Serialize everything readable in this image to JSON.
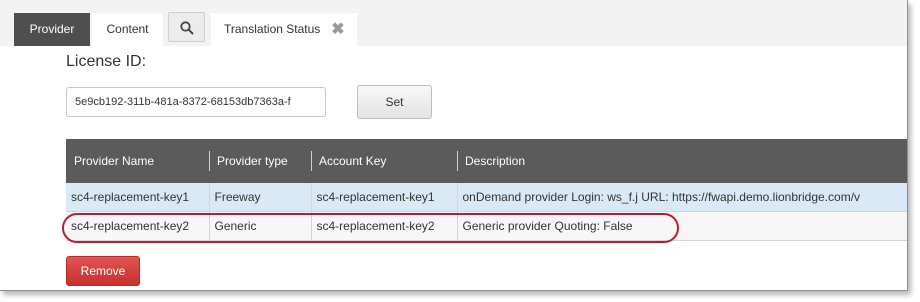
{
  "tabs": {
    "provider": "Provider",
    "content": "Content",
    "search_icon": "search-icon",
    "translation_status": "Translation Status",
    "close_icon": "close-icon",
    "close_glyph": "✖"
  },
  "license": {
    "label": "License ID:",
    "value": "5e9cb192-311b-481a-8372-68153db7363a-f",
    "set_label": "Set"
  },
  "table": {
    "headers": [
      "Provider Name",
      "Provider type",
      "Account Key",
      "Description"
    ],
    "rows": [
      [
        "sc4-replacement-key1",
        "Freeway",
        "sc4-replacement-key1",
        "onDemand provider Login: ws_f.j URL: https://fwapi.demo.lionbridge.com/v"
      ],
      [
        "sc4-replacement-key2",
        "Generic",
        "sc4-replacement-key2",
        "Generic provider Quoting: False"
      ]
    ]
  },
  "actions": {
    "remove_label": "Remove"
  },
  "colors": {
    "active_tab": "#4f4f4f",
    "header_bg": "#5b5b5b",
    "selected_row": "#d9eaf6",
    "remove_button": "#c9302c",
    "highlight_oval": "#c0192f"
  }
}
